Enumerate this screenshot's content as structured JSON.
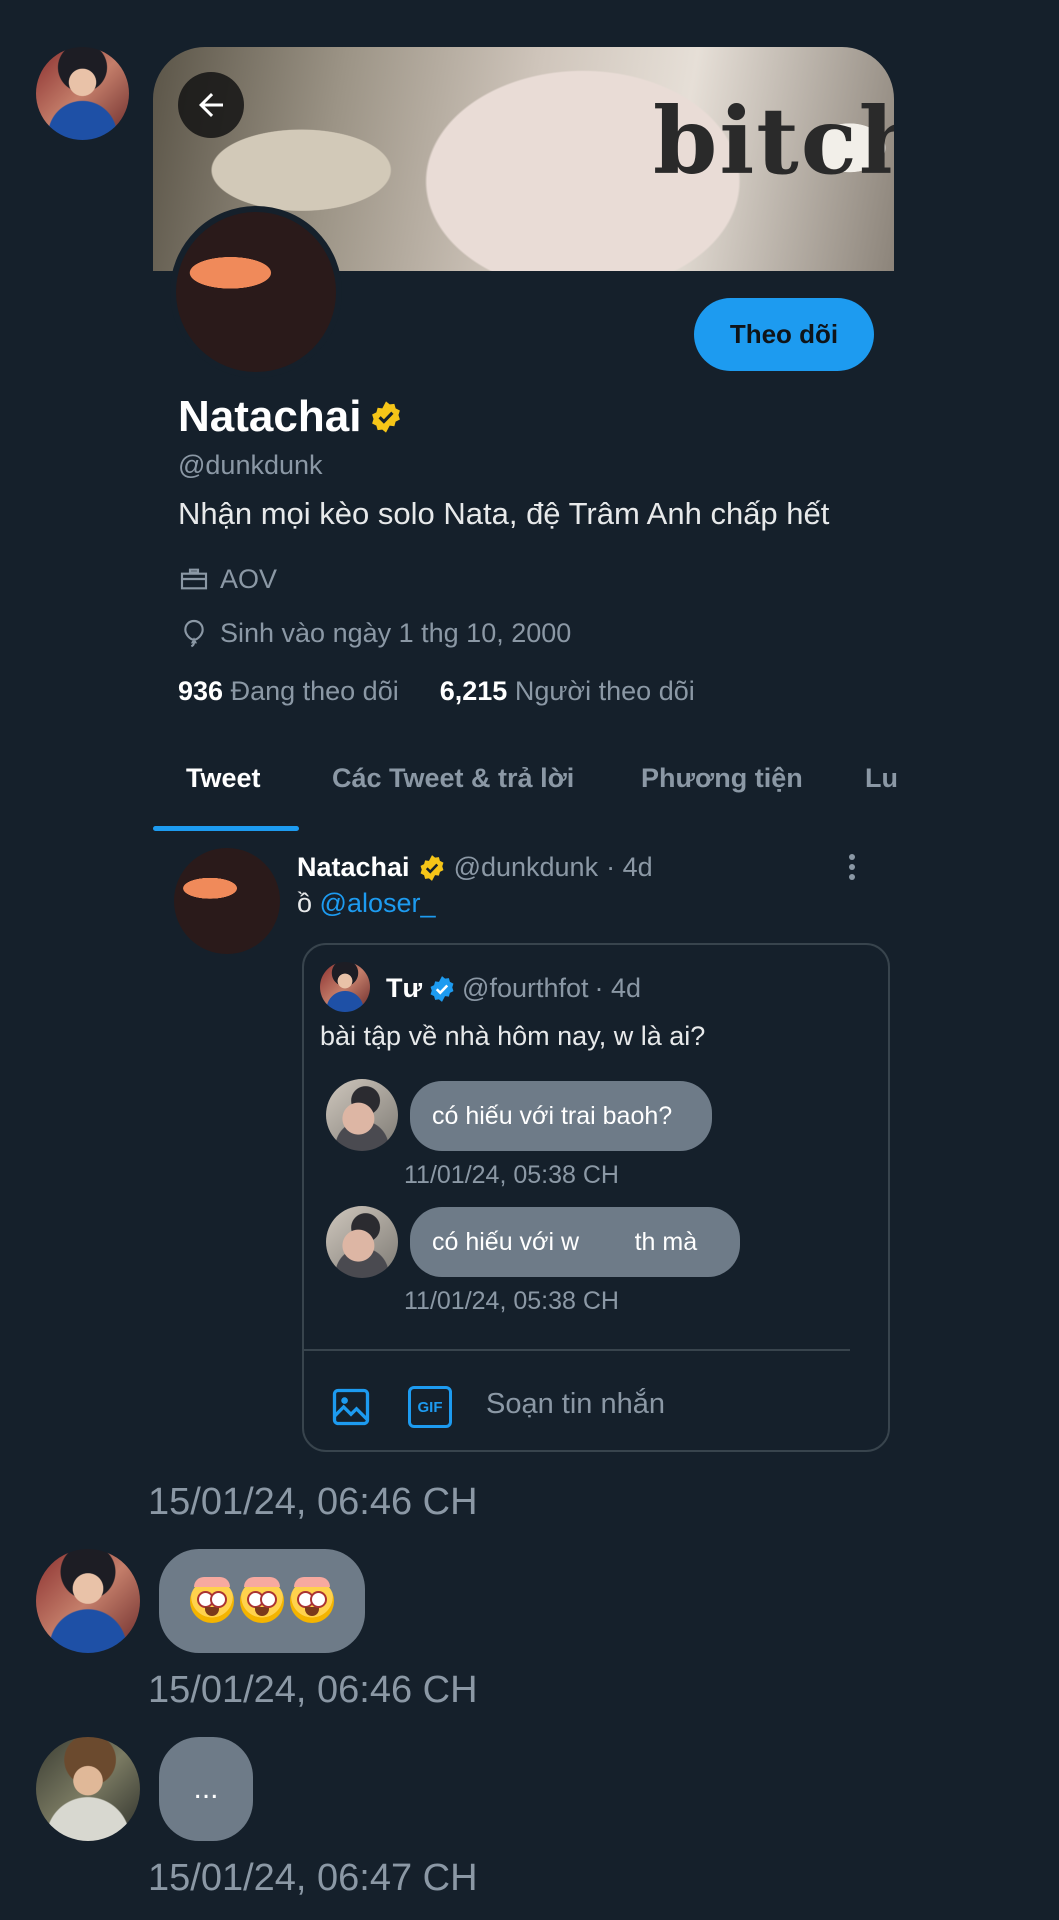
{
  "profile": {
    "banner_word": "bitch",
    "name": "Natachai",
    "handle": "@dunkdunk",
    "bio": "Nhận mọi kèo solo Nata, đệ Trâm Anh chấp hết",
    "category": "AOV",
    "birthday": "Sinh vào ngày 1 thg 10, 2000",
    "following_count": "936",
    "following_label": "Đang theo dõi",
    "followers_count": "6,215",
    "followers_label": "Người theo dõi",
    "follow_button": "Theo dõi",
    "verified_color": "#f5c518"
  },
  "tabs": [
    {
      "label": "Tweet",
      "active": true
    },
    {
      "label": "Các Tweet & trả lời"
    },
    {
      "label": "Phương tiện"
    },
    {
      "label": "Lu"
    }
  ],
  "tweet": {
    "name": "Natachai",
    "handle": "@dunkdunk",
    "age": "· 4d",
    "text_prefix": "ồ",
    "mention": "@aloser_",
    "quoted": {
      "name": "Tư",
      "handle": "@fourthfot",
      "age": "· 4d",
      "text": "bài tập về nhà hôm nay, w là ai?",
      "dms": [
        {
          "text": "có hiếu với trai baoh?",
          "time": "11/01/24, 05:38 CH"
        },
        {
          "text": "có hiếu với w        th mà",
          "time": "11/01/24, 05:38 CH"
        }
      ],
      "compose_placeholder": "Soạn tin nhắn",
      "gif_label": "GIF"
    }
  },
  "chat": [
    {
      "timestamp": "15/01/24, 06:46 CH"
    },
    {
      "timestamp": "15/01/24, 06:46 CH",
      "message": "😳😳😳"
    },
    {
      "timestamp": "15/01/24, 06:47 CH",
      "message": "..."
    }
  ],
  "colors": {
    "background": "#15202b",
    "accent": "#1d9bf0",
    "muted": "#8b98a5",
    "bubble": "#6e7b88"
  }
}
